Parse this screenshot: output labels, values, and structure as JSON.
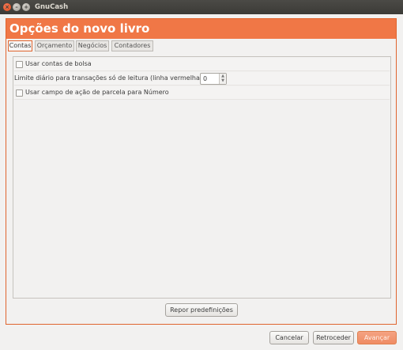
{
  "window": {
    "app_title": "GnuCash",
    "close_glyph": "×",
    "min_glyph": "–",
    "max_glyph": "+"
  },
  "header": {
    "title": "Opções do novo livro"
  },
  "tabs": [
    {
      "label": "Contas"
    },
    {
      "label": "Orçamento"
    },
    {
      "label": "Negócios"
    },
    {
      "label": "Contadores"
    }
  ],
  "options": {
    "use_trading_accounts": {
      "label": "Usar contas de bolsa",
      "checked": false
    },
    "read_only_threshold": {
      "label": "Limite diário para transações só de leitura (linha vermelha):",
      "value": "0"
    },
    "use_split_action": {
      "label": "Usar campo de ação de parcela para Número",
      "checked": false
    }
  },
  "buttons": {
    "reset": "Repor predefinições",
    "cancel": "Cancelar",
    "back": "Retroceder",
    "forward": "Avançar"
  },
  "colors": {
    "accent": "#f07746",
    "titlebar": "#3c3b37"
  }
}
